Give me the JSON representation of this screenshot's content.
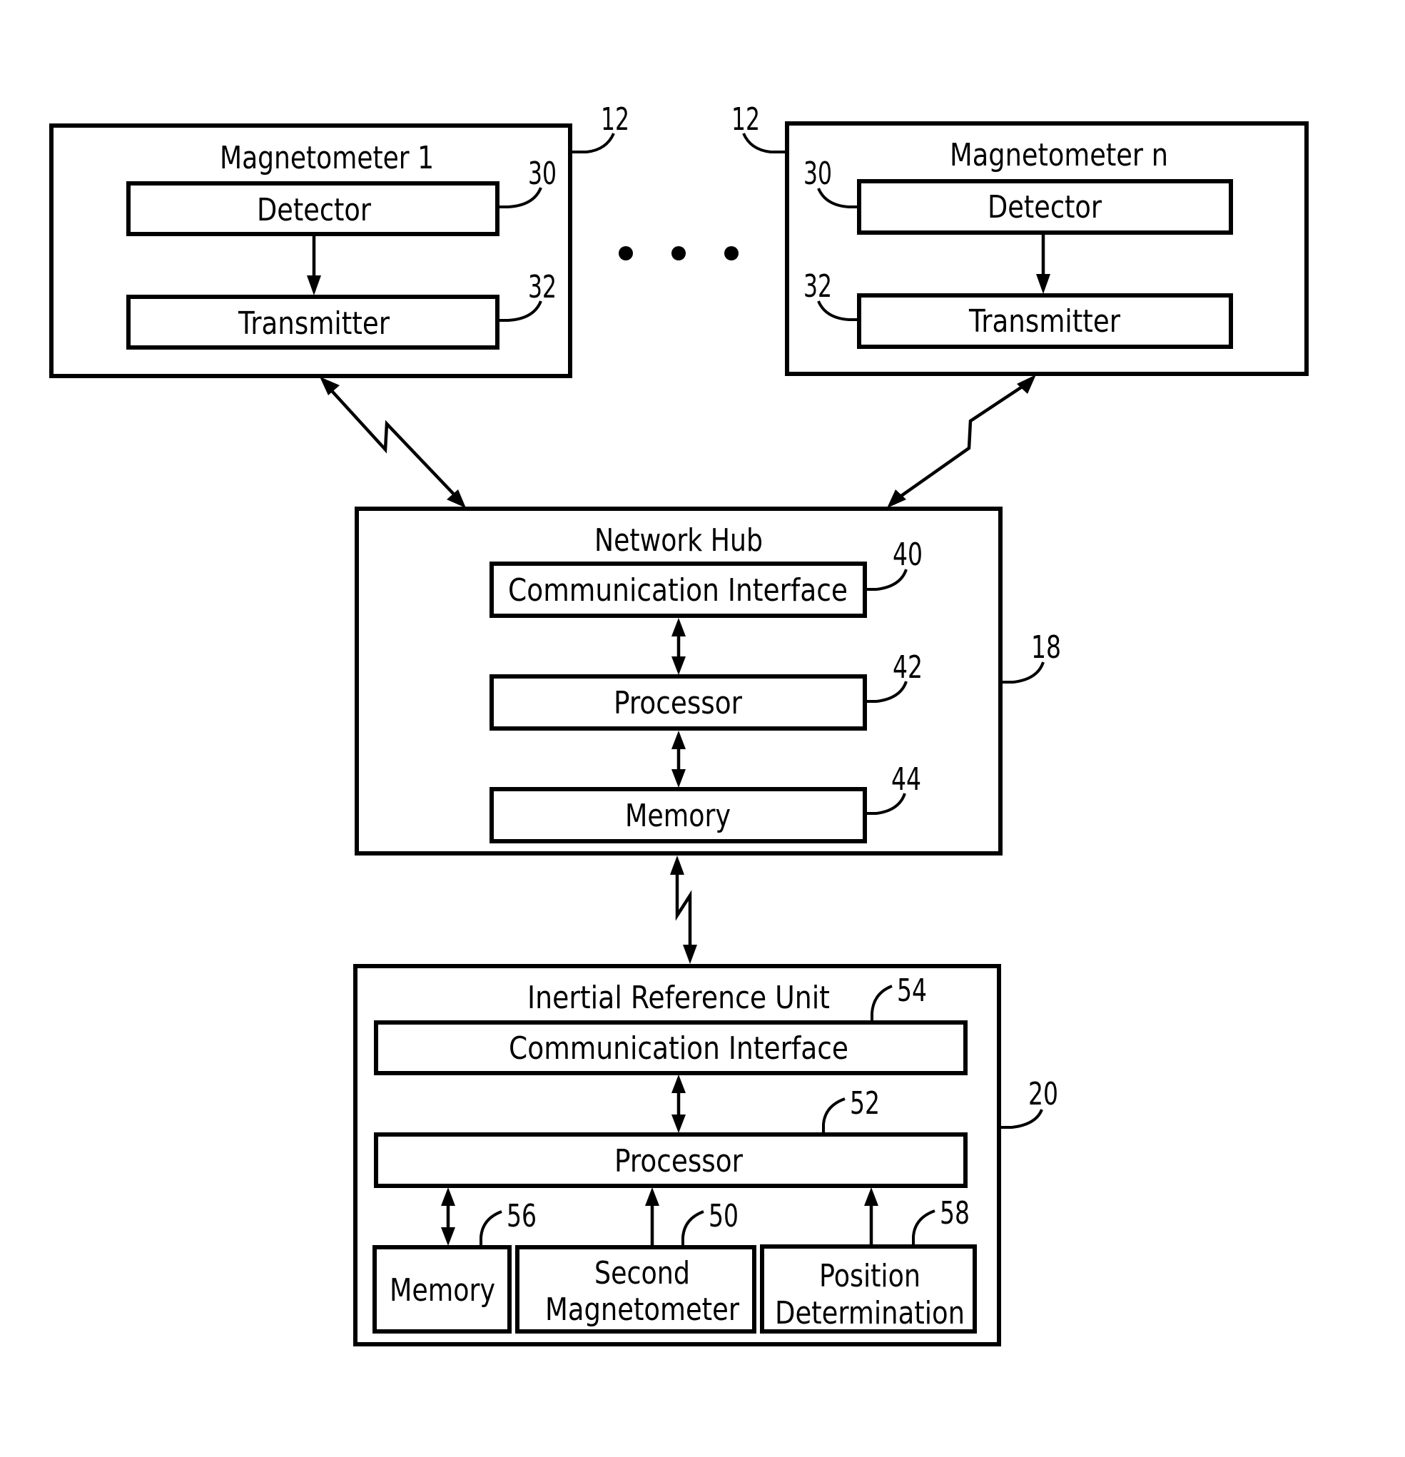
{
  "diagram": {
    "magnetometer_1": {
      "title": "Magnetometer 1",
      "ref": "12",
      "detector": {
        "label": "Detector",
        "ref": "30"
      },
      "transmitter": {
        "label": "Transmitter",
        "ref": "32"
      }
    },
    "magnetometer_n": {
      "title": "Magnetometer n",
      "ref": "12",
      "detector": {
        "label": "Detector",
        "ref": "30"
      },
      "transmitter": {
        "label": "Transmitter",
        "ref": "32"
      }
    },
    "ellipsis": "• • •",
    "network_hub": {
      "title": "Network Hub",
      "ref": "18",
      "communication_interface": {
        "label": "Communication Interface",
        "ref": "40"
      },
      "processor": {
        "label": "Processor",
        "ref": "42"
      },
      "memory": {
        "label": "Memory",
        "ref": "44"
      }
    },
    "inertial_reference_unit": {
      "title": "Inertial Reference Unit",
      "ref": "20",
      "communication_interface": {
        "label": "Communication Interface",
        "ref": "54"
      },
      "processor": {
        "label": "Processor",
        "ref": "52"
      },
      "memory": {
        "label": "Memory",
        "ref": "56"
      },
      "second_magnetometer": {
        "label_line1": "Second",
        "label_line2": "Magnetometer",
        "ref": "50"
      },
      "position_determination": {
        "label_line1": "Position",
        "label_line2": "Determination",
        "ref": "58"
      }
    },
    "connections": [
      {
        "from": "Detector",
        "to": "Transmitter",
        "type": "one-way",
        "within": "Magnetometer 1"
      },
      {
        "from": "Detector",
        "to": "Transmitter",
        "type": "one-way",
        "within": "Magnetometer n"
      },
      {
        "from": "Magnetometer 1",
        "to": "Network Hub",
        "type": "wireless-bidirectional"
      },
      {
        "from": "Magnetometer n",
        "to": "Network Hub",
        "type": "wireless-bidirectional"
      },
      {
        "from": "Communication Interface",
        "to": "Processor",
        "type": "bidirectional",
        "within": "Network Hub"
      },
      {
        "from": "Processor",
        "to": "Memory",
        "type": "bidirectional",
        "within": "Network Hub"
      },
      {
        "from": "Network Hub",
        "to": "Inertial Reference Unit",
        "type": "wireless-bidirectional"
      },
      {
        "from": "Communication Interface",
        "to": "Processor",
        "type": "bidirectional",
        "within": "Inertial Reference Unit"
      },
      {
        "from": "Processor",
        "to": "Memory",
        "type": "bidirectional",
        "within": "Inertial Reference Unit"
      },
      {
        "from": "Second Magnetometer",
        "to": "Processor",
        "type": "one-way",
        "within": "Inertial Reference Unit"
      },
      {
        "from": "Position Determination",
        "to": "Processor",
        "type": "one-way",
        "within": "Inertial Reference Unit"
      }
    ]
  }
}
